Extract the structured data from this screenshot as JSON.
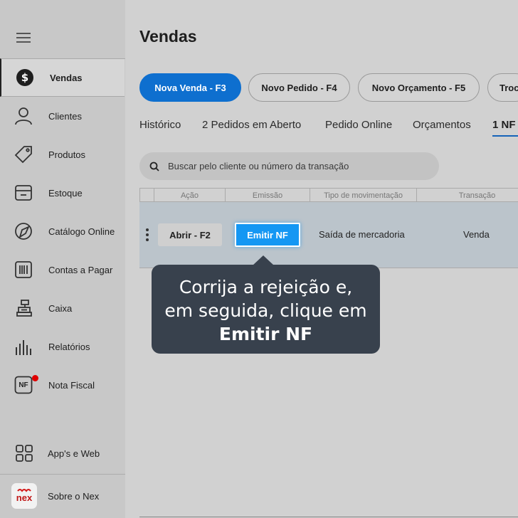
{
  "sidebar": {
    "menu_icon": "hamburger-icon",
    "items": [
      {
        "label": "Vendas",
        "icon": "dollar-circle-icon",
        "active": true
      },
      {
        "label": "Clientes",
        "icon": "user-icon"
      },
      {
        "label": "Produtos",
        "icon": "tag-icon"
      },
      {
        "label": "Estoque",
        "icon": "box-icon"
      },
      {
        "label": "Catálogo Online",
        "icon": "catalog-icon"
      },
      {
        "label": "Contas a Pagar",
        "icon": "barcode-icon"
      },
      {
        "label": "Caixa",
        "icon": "cash-register-icon"
      },
      {
        "label": "Relatórios",
        "icon": "bar-chart-icon"
      },
      {
        "label": "Nota Fiscal",
        "icon": "nf-icon",
        "badge_color": "#e00000",
        "icon_text": "NF"
      }
    ],
    "apps_label": "App's e Web",
    "about_label": "Sobre o Nex",
    "about_logo_text": "nex"
  },
  "main": {
    "title": "Vendas",
    "actions": [
      {
        "label": "Nova Venda - F3",
        "primary": true
      },
      {
        "label": "Novo Pedido - F4"
      },
      {
        "label": "Novo Orçamento - F5"
      },
      {
        "label": "Troc"
      }
    ],
    "tabs": [
      {
        "label": "Histórico"
      },
      {
        "label": "2 Pedidos em Aberto"
      },
      {
        "label": "Pedido Online"
      },
      {
        "label": "Orçamentos"
      },
      {
        "label": "1 NF",
        "active": true
      }
    ],
    "search": {
      "placeholder": "Buscar pelo cliente ou número da transação"
    },
    "table": {
      "headers": [
        "Ação",
        "Emissão",
        "Tipo de movimentação",
        "Transação"
      ],
      "rows": [
        {
          "open_label": "Abrir - F2",
          "emit_label": "Emitir NF",
          "movement_type": "Saída de mercadoria",
          "transaction": "Venda"
        }
      ]
    },
    "tooltip": {
      "line1": "Corrija a rejeição e,",
      "line2": "em seguida, clique em",
      "line3": "Emitir NF"
    }
  },
  "colors": {
    "primary": "#0e6fcf",
    "emit_button": "#1597f3",
    "tooltip_bg": "#38414d",
    "tab_underline": "#1663b9"
  }
}
